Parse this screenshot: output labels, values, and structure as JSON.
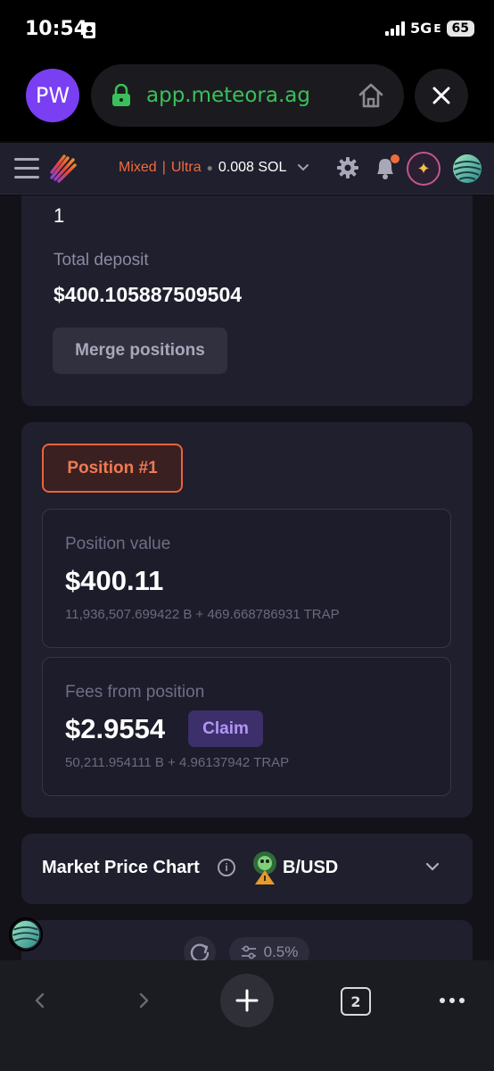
{
  "status_bar": {
    "time": "10:54",
    "network": "5G",
    "network_sub": "E",
    "battery": "65"
  },
  "browser": {
    "profile_initials": "PW",
    "url": "app.meteora.ag"
  },
  "header": {
    "mode_mixed": "Mixed",
    "mode_separator": "|",
    "mode_ultra": "Ultra",
    "balance": "0.008 SOL",
    "accent_color": "#f26b3a"
  },
  "summary": {
    "positions_count": "1",
    "total_deposit_label": "Total deposit",
    "total_deposit_value": "$400.105887509504",
    "merge_button": "Merge positions"
  },
  "position": {
    "badge": "Position #1",
    "value_label": "Position value",
    "value": "$400.11",
    "value_detail": "11,936,507.699422 B + 469.668786931 TRAP",
    "fees_label": "Fees from position",
    "fees_value": "$2.9554",
    "claim_button": "Claim",
    "fees_detail": "50,211.954111 B + 4.96137942 TRAP"
  },
  "market_chart": {
    "title": "Market Price Chart",
    "info_icon": "i",
    "pair": "B/USD"
  },
  "swap": {
    "slippage": "0.5%"
  },
  "bottom_nav": {
    "tabs_count": "2"
  }
}
